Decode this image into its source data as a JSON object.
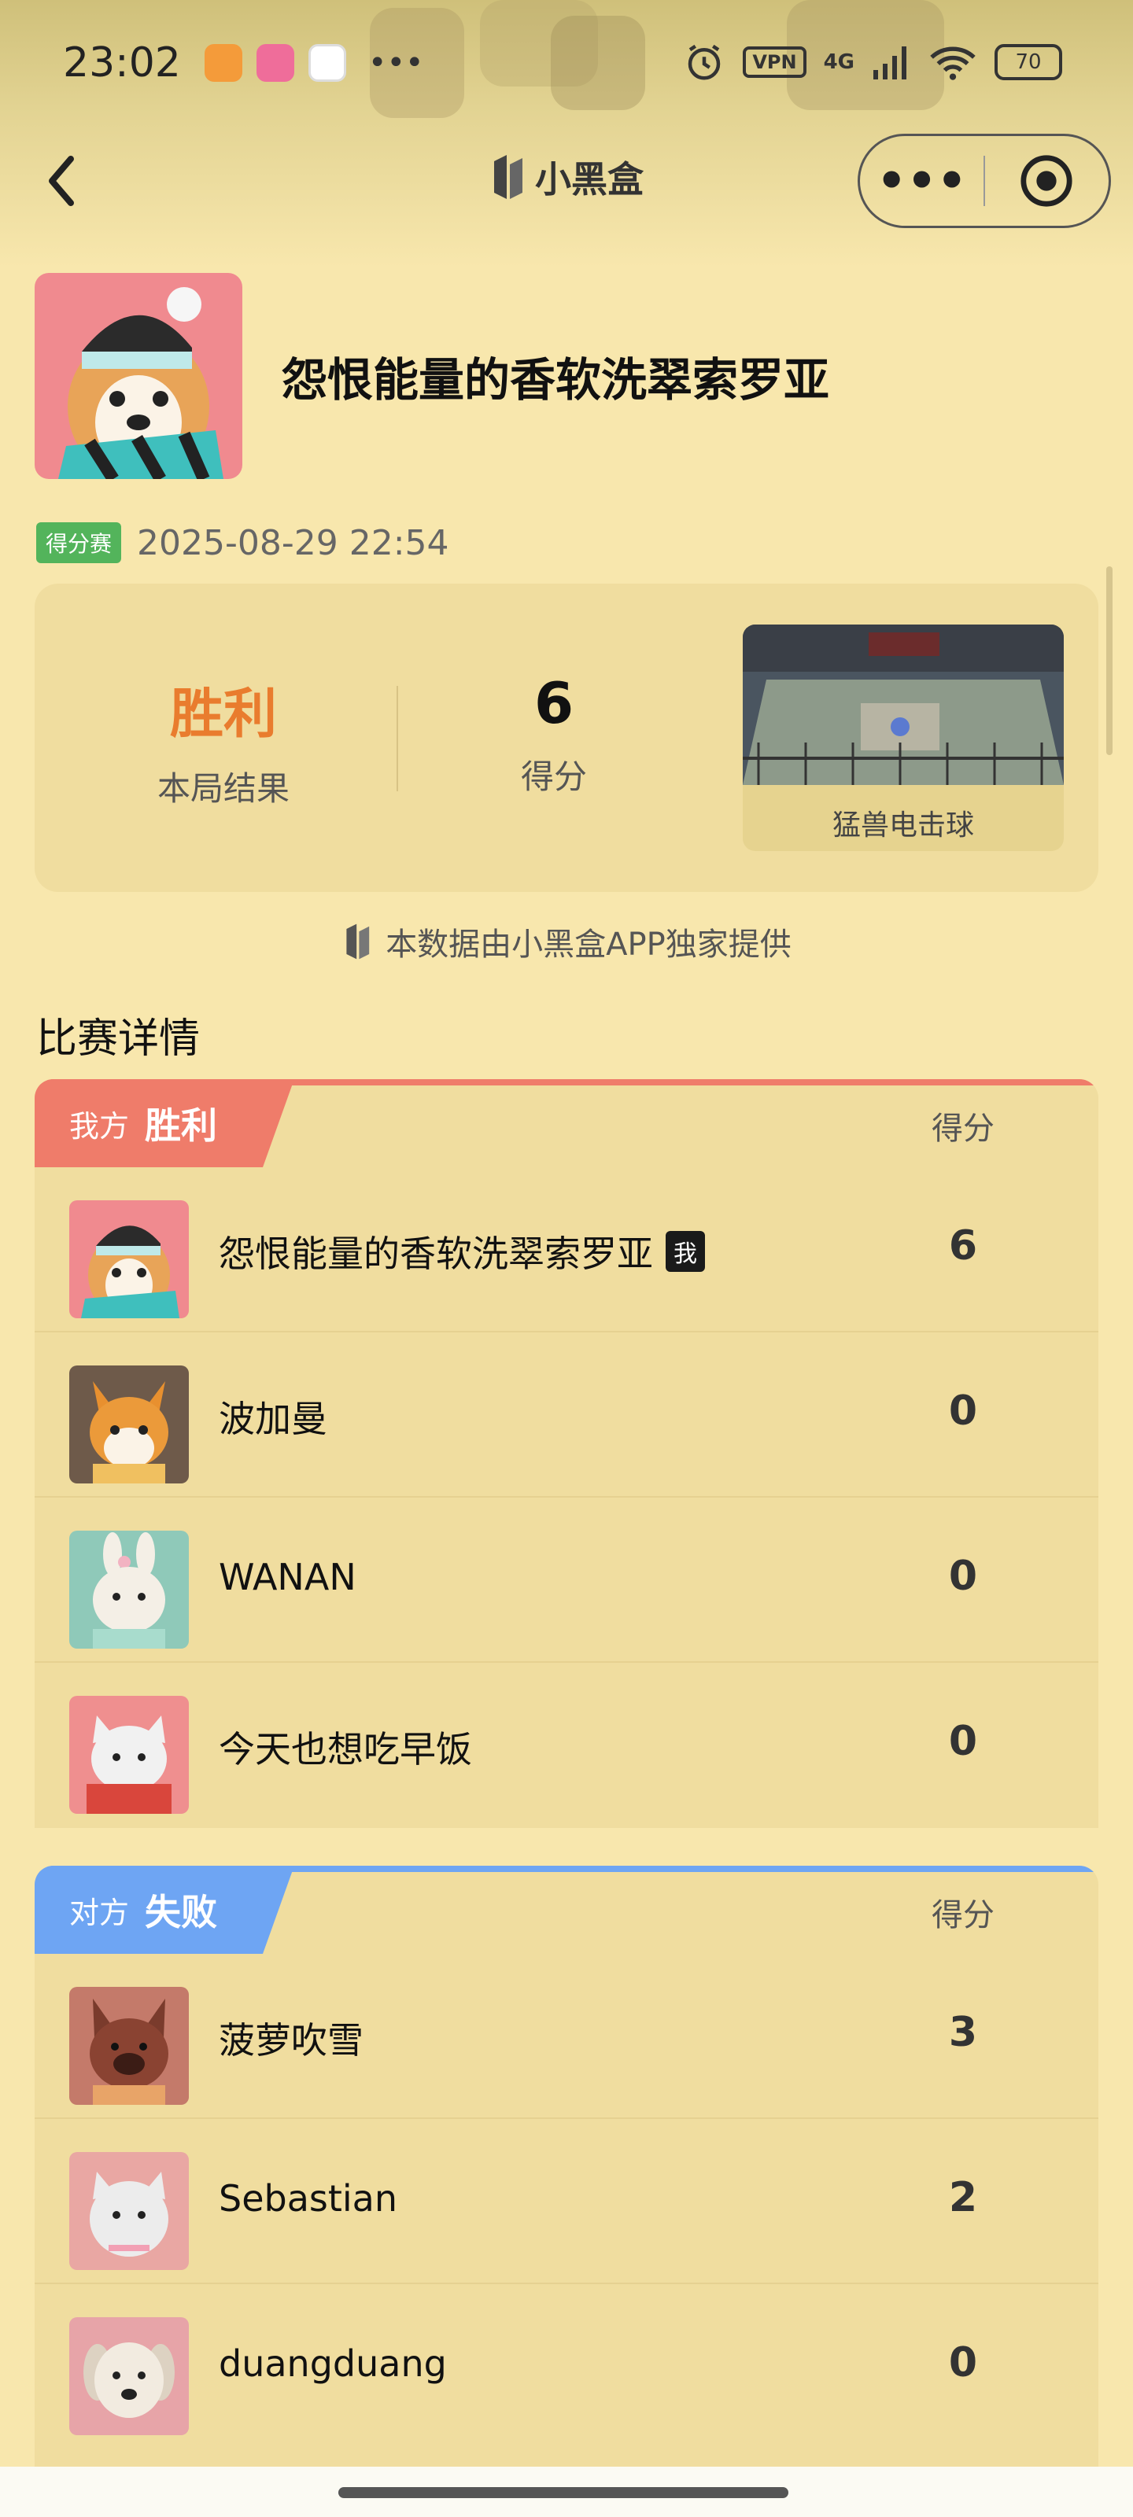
{
  "status_bar": {
    "time": "23:02",
    "network": "4G",
    "vpn_label": "VPN",
    "battery": "70"
  },
  "nav": {
    "title": "小黑盒"
  },
  "player": {
    "name": "怨恨能量的香软洗翠索罗亚"
  },
  "match": {
    "mode_badge": "得分赛",
    "datetime": "2025-08-29 22:54",
    "result_value": "胜利",
    "result_label": "本局结果",
    "score_value": "6",
    "score_label": "得分",
    "map_name": "猛兽电击球"
  },
  "provider_text": "本数据由小黑盒APP独家提供",
  "section_title": "比赛详情",
  "teams": {
    "mine": {
      "side": "我方",
      "result": "胜利",
      "score_header": "得分",
      "color": "#ef7c6a",
      "players": [
        {
          "name": "怨恨能量的香软洗翠索罗亚",
          "badge": "我",
          "score": "6"
        },
        {
          "name": "波加曼",
          "score": "0"
        },
        {
          "name": "WANAN",
          "score": "0"
        },
        {
          "name": "今天也想吃早饭",
          "score": "0"
        }
      ]
    },
    "enemy": {
      "side": "对方",
      "result": "失败",
      "score_header": "得分",
      "color": "#6ea5f3",
      "players": [
        {
          "name": "菠萝吹雪",
          "score": "3"
        },
        {
          "name": "Sebastian",
          "score": "2"
        },
        {
          "name": "duangduang",
          "score": "0"
        }
      ]
    }
  },
  "colors": {
    "win": "#e97c2e",
    "background": "#f8e7ad",
    "card": "#f0dd9f"
  }
}
